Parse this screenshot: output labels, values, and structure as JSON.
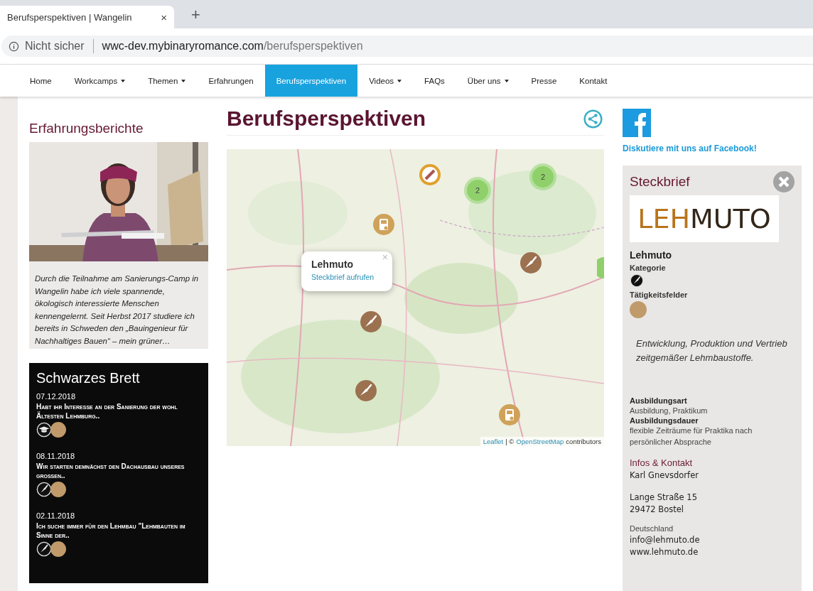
{
  "browser": {
    "tab_title": "Berufsperspektiven | Wangelin",
    "tab_close": "×",
    "new_tab": "+",
    "security": "Nicht sicher",
    "url_host": "wwc-dev.mybinaryromance.com",
    "url_path": "/berufsperspektiven"
  },
  "nav": [
    {
      "label": "Home",
      "dropdown": false,
      "selected": false
    },
    {
      "label": "Workcamps",
      "dropdown": true,
      "selected": false
    },
    {
      "label": "Themen",
      "dropdown": true,
      "selected": false
    },
    {
      "label": "Erfahrungen",
      "dropdown": false,
      "selected": false
    },
    {
      "label": "Berufsperspektiven",
      "dropdown": false,
      "selected": true
    },
    {
      "label": "Videos",
      "dropdown": true,
      "selected": false
    },
    {
      "label": "FAQs",
      "dropdown": false,
      "selected": false
    },
    {
      "label": "Über uns",
      "dropdown": true,
      "selected": false
    },
    {
      "label": "Presse",
      "dropdown": false,
      "selected": false
    },
    {
      "label": "Kontakt",
      "dropdown": false,
      "selected": false
    }
  ],
  "reports": {
    "title": "Erfahrungsberichte",
    "quote": "Durch die Teilnahme am Sanierungs-Camp in Wangelin habe ich viele spannende, ökologisch interessierte Menschen kennengelernt. Seit Herbst 2017 studiere ich bereits in Schweden den „Bauingenieur für Nachhaltiges Bauen“ – mein grüner…"
  },
  "board": {
    "title": "Schwarzes Brett",
    "posts": [
      {
        "date": "07.12.2018",
        "text": "Habt ihr Interesse an der Sanierung der wohl Ältesten Lehmburg..",
        "kind": "cap",
        "color": "#c19a6b"
      },
      {
        "date": "08.11.2018",
        "text": "Wir starten demnächst den Dachausbau unseres grossen..",
        "kind": "trowel",
        "color": "#c19a6b"
      },
      {
        "date": "02.11.2018",
        "text": "Ich suche immer für den Lehmbau \"Lehmbauten im Sinne der..",
        "kind": "trowel",
        "color": "#c19a6b"
      }
    ]
  },
  "main": {
    "title": "Berufsperspektiven",
    "map": {
      "markers": [
        {
          "kind": "question"
        },
        {
          "kind": "cluster",
          "count": "2"
        },
        {
          "kind": "cluster",
          "count": "2"
        },
        {
          "kind": "device"
        },
        {
          "kind": "trowel"
        },
        {
          "kind": "cluster_edge"
        },
        {
          "kind": "trowel"
        },
        {
          "kind": "trowel"
        },
        {
          "kind": "device"
        }
      ],
      "popup": {
        "title": "Lehmuto",
        "link": "Steckbrief aufrufen",
        "close": "×"
      },
      "attribution": {
        "leaflet": "Leaflet",
        "separator": "| ©",
        "osm": "OpenStreetMap",
        "rest": "contributors"
      }
    }
  },
  "facebook": {
    "link": "Diskutiere mit uns auf Facebook!"
  },
  "profile": {
    "title": "Steckbrief",
    "logo_lead": "LEH",
    "logo_rest": "MUTO",
    "name": "Lehmuto",
    "category_label": "Kategorie",
    "category": {
      "kind": "trowel"
    },
    "fields_label": "Tätigkeitsfelder",
    "field": {
      "color": "#c19a6b"
    },
    "description": "Entwicklung, Produktion und Vertrieb zeitgemäßer Lehmbaustoffe.",
    "details": [
      {
        "label": "Ausbildungsart",
        "value": "Ausbildung, Praktikum"
      },
      {
        "label": "Ausbildungsdauer",
        "value": "flexible Zeiträume für Praktika nach persönlicher Absprache"
      }
    ],
    "contact_title": "Infos & Kontakt",
    "contact_name": "Karl  Gnevsdorfer",
    "street": "Lange Straße 15",
    "city": "29472 Bostel",
    "country": "Deutschland",
    "email": "info@lehmuto.de",
    "web": "www.lehmuto.de"
  }
}
